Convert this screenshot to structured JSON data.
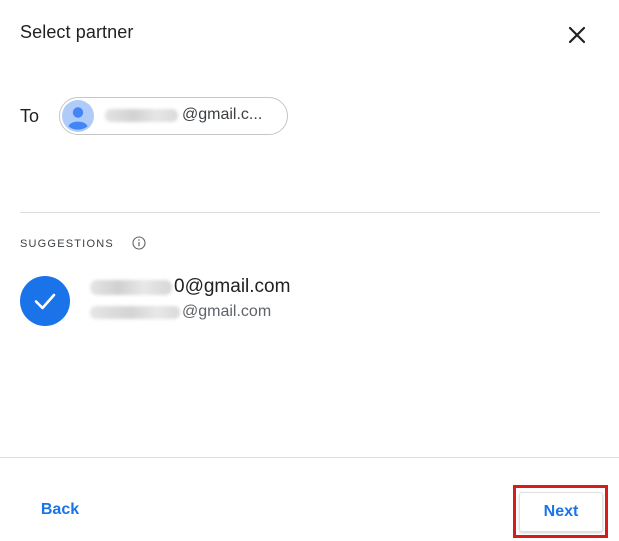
{
  "dialog": {
    "title": "Select partner",
    "close_icon": "close-icon"
  },
  "recipient": {
    "to_label": "To",
    "chip_email_visible": "@gmail.c...",
    "avatar_icon": "person-avatar-icon"
  },
  "suggestions": {
    "label": "SUGGESTIONS",
    "info_icon": "info-icon",
    "items": [
      {
        "selected": true,
        "check_icon": "check-circle-icon",
        "primary_visible": "0@gmail.com",
        "secondary_visible": "@gmail.com"
      }
    ]
  },
  "footer": {
    "back_label": "Back",
    "next_label": "Next"
  },
  "colors": {
    "accent": "#1a73e8",
    "text": "#202124",
    "divider": "#dadce0",
    "highlight": "#d81b1b"
  }
}
